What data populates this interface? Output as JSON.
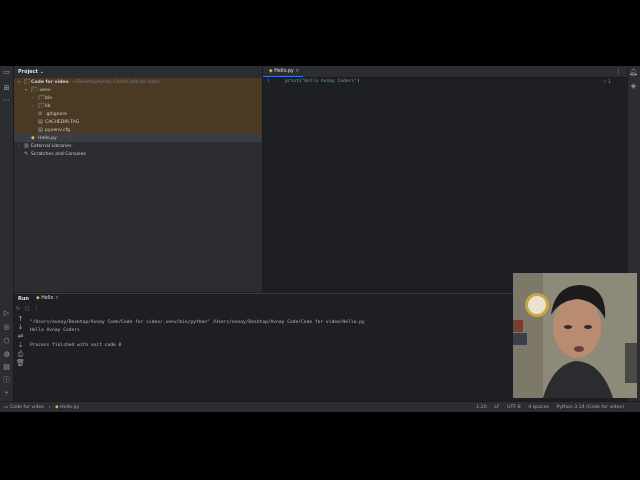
{
  "sidebar": {
    "title": "Project"
  },
  "tree": [
    {
      "label": "Code for video",
      "path": "~/Desktop/Avnay Code/Code for video",
      "icon": "folder",
      "arrow": "▾",
      "indent": 0,
      "state": "hl"
    },
    {
      "label": ".venv",
      "icon": "folder",
      "arrow": "▾",
      "indent": 1,
      "state": "hl"
    },
    {
      "label": "bin",
      "icon": "folder",
      "arrow": "›",
      "indent": 2,
      "state": "hl"
    },
    {
      "label": "lib",
      "icon": "folder",
      "arrow": "›",
      "indent": 2,
      "state": "hl"
    },
    {
      "label": ".gitignore",
      "icon": "gitignore",
      "arrow": "",
      "indent": 2,
      "state": "hl"
    },
    {
      "label": "CACHEDIR.TAG",
      "icon": "file",
      "arrow": "",
      "indent": 2,
      "state": "hl"
    },
    {
      "label": "pyvenv.cfg",
      "icon": "file",
      "arrow": "",
      "indent": 2,
      "state": "hl"
    },
    {
      "label": "Hello.py",
      "icon": "python",
      "arrow": "",
      "indent": 1,
      "state": "sel"
    },
    {
      "label": "External Libraries",
      "icon": "library",
      "arrow": "›",
      "indent": 0,
      "state": ""
    },
    {
      "label": "Scratches and Consoles",
      "icon": "scratch",
      "arrow": "",
      "indent": 0,
      "state": ""
    }
  ],
  "editor": {
    "tab": "Hello.py",
    "line_number": "1",
    "code_fn": "print",
    "code_open": "(",
    "code_str": "\"Hello Avnay Coders\"",
    "code_close": ")",
    "check": "✓ 1"
  },
  "run": {
    "title": "Run",
    "tab": "Hello",
    "output": [
      "\"/Users/avnay/Desktop/Avnay Code/Code for video/.venv/bin/python\" /Users/avnay/Desktop/Avnay Code/Code for video/Hello.py",
      "Hello Avnay Coders",
      "",
      "Process finished with exit code 0"
    ]
  },
  "statusbar": {
    "crumb_project": "Code for video",
    "crumb_file": "Hello.py",
    "position": "1:20",
    "line_sep": "LF",
    "encoding": "UTF-8",
    "indent": "4 spaces",
    "interpreter": "Python 3.14 (Code for video)"
  }
}
